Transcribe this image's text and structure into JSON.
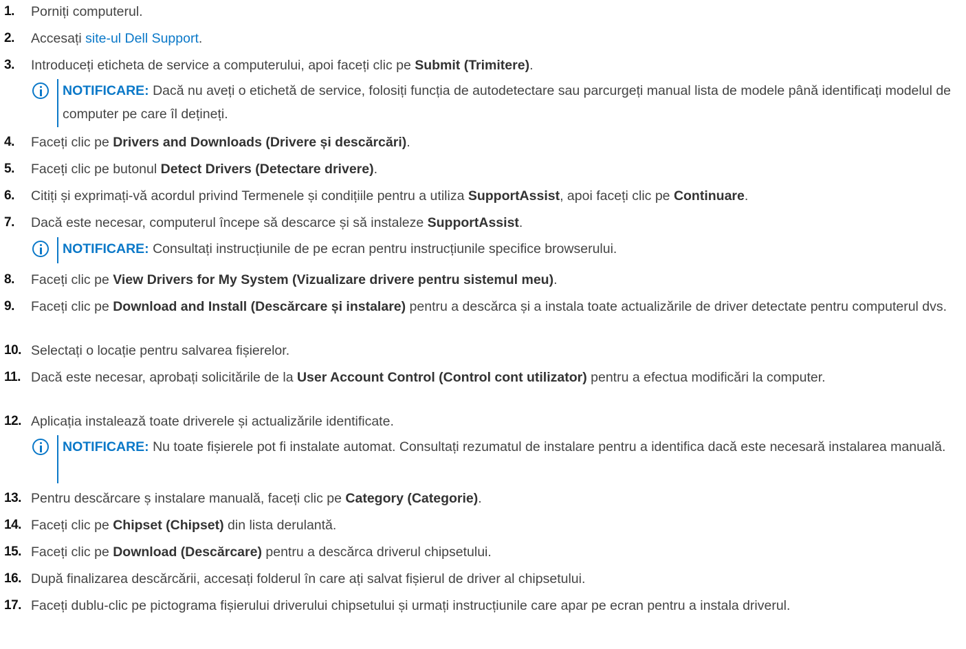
{
  "accent_color": "#0a78c8",
  "note_icon": "info-circle-icon",
  "steps": [
    {
      "num": "1.",
      "parts": [
        "Porniți computerul."
      ]
    },
    {
      "num": "2.",
      "parts": [
        "Accesați ",
        "site-ul Dell Support",
        "."
      ]
    },
    {
      "num": "3.",
      "parts": [
        "Introduceți eticheta de service a computerului, apoi faceți clic pe ",
        "Submit (Trimitere)",
        "."
      ]
    },
    {
      "num": "4.",
      "parts": [
        "Faceți clic pe ",
        "Drivers and Downloads (Drivere și descărcări)",
        "."
      ]
    },
    {
      "num": "5.",
      "parts": [
        "Faceți clic pe butonul ",
        "Detect Drivers (Detectare drivere)",
        "."
      ]
    },
    {
      "num": "6.",
      "parts": [
        "Citiți și exprimați-vă acordul privind Termenele și condițiile pentru a utiliza ",
        "SupportAssist",
        ", apoi faceți clic pe ",
        "Continuare",
        "."
      ]
    },
    {
      "num": "7.",
      "parts": [
        "Dacă este necesar, computerul începe să descarce și să instaleze ",
        "SupportAssist",
        "."
      ]
    },
    {
      "num": "8.",
      "parts": [
        "Faceți clic pe ",
        "View Drivers for My System (Vizualizare drivere pentru sistemul meu)",
        "."
      ]
    },
    {
      "num": "9.",
      "parts": [
        "Faceți clic pe ",
        "Download and Install (Descărcare și instalare)",
        " pentru a descărca și a instala toate actualizările de driver detectate pentru computerul dvs."
      ]
    },
    {
      "num": "10.",
      "parts": [
        "Selectați o locație pentru salvarea fișierelor."
      ]
    },
    {
      "num": "11.",
      "parts": [
        "Dacă este necesar, aprobați solicitările de la ",
        "User Account Control (Control cont utilizator)",
        " pentru a efectua modificări la computer."
      ]
    },
    {
      "num": "12.",
      "parts": [
        "Aplicația instalează toate driverele și actualizările identificate."
      ]
    },
    {
      "num": "13.",
      "parts": [
        "Pentru descărcare ș instalare manuală, faceți clic pe ",
        "Category (Categorie)",
        "."
      ]
    },
    {
      "num": "14.",
      "parts": [
        "Faceți clic pe ",
        "Chipset (Chipset)",
        " din lista derulantă."
      ]
    },
    {
      "num": "15.",
      "parts": [
        "Faceți clic pe ",
        "Download (Descărcare)",
        " pentru a descărca driverul chipsetului."
      ]
    },
    {
      "num": "16.",
      "parts": [
        "După finalizarea descărcării, accesați folderul în care ați salvat fișierul de driver al chipsetului."
      ]
    },
    {
      "num": "17.",
      "parts": [
        "Faceți dublu-clic pe pictograma fișierului driverului chipsetului și urmați instrucțiunile care apar pe ecran pentru a instala driverul."
      ]
    }
  ],
  "notes": [
    {
      "title": "NOTIFICARE:",
      "text": " Dacă nu aveți o etichetă de service, folosiți funcția de autodetectare sau parcurgeți manual lista de modele până identificați modelul de computer pe care îl dețineți."
    },
    {
      "title": "NOTIFICARE:",
      "text": " Consultați instrucțiunile de pe ecran pentru instrucțiunile specifice browserului."
    },
    {
      "title": "NOTIFICARE:",
      "text": " Nu toate fișierele pot fi instalate automat. Consultați rezumatul de instalare pentru a identifica dacă este necesară instalarea manuală."
    }
  ]
}
